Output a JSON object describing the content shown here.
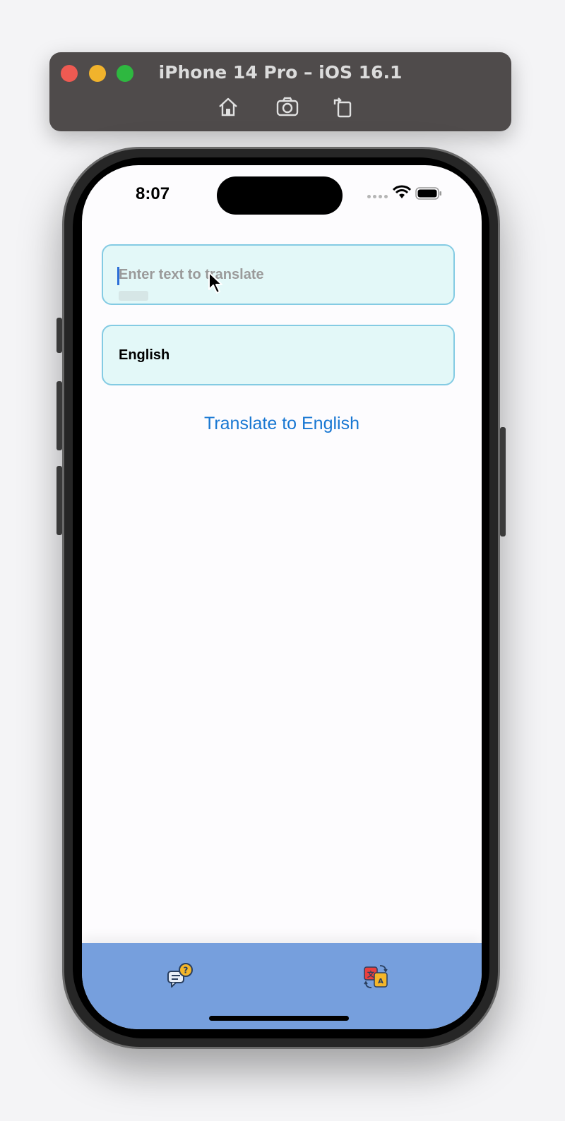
{
  "simulator": {
    "title": "iPhone 14 Pro – iOS 16.1",
    "toolbar": [
      "home-icon",
      "screenshot-icon",
      "rotate-icon"
    ]
  },
  "status_bar": {
    "time": "8:07"
  },
  "input": {
    "placeholder": "Enter text to translate",
    "value": ""
  },
  "language": {
    "selected": "English"
  },
  "action": {
    "translate_label": "Translate to English"
  },
  "tabbar": {
    "tabs": [
      "chat-question-icon",
      "translate-icon"
    ],
    "background": "#769fdd"
  },
  "colors": {
    "accent": "#1877d2",
    "field_bg": "#e3f8f8",
    "field_border": "#84cbe3"
  }
}
